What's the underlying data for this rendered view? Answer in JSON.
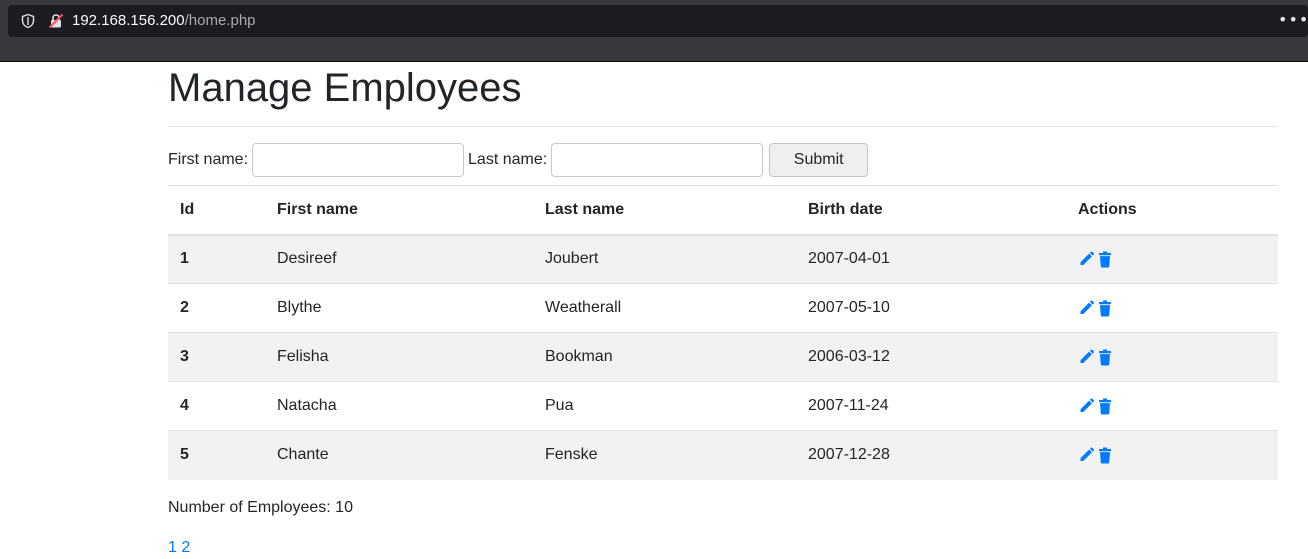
{
  "browser": {
    "url_host": "192.168.156.200",
    "url_path": "/home.php",
    "menu_glyph": "•••",
    "icons": {
      "shield": "shield-icon",
      "insecure": "insecure-lock-icon",
      "menu": "more-menu-icon"
    }
  },
  "page": {
    "title": "Manage Employees"
  },
  "search": {
    "first_label": "First name:",
    "first_value": "",
    "last_label": "Last name:",
    "last_value": "",
    "submit_label": "Submit"
  },
  "table": {
    "headers": {
      "id": "Id",
      "first": "First name",
      "last": "Last name",
      "birth": "Birth date",
      "actions": "Actions"
    },
    "rows": [
      {
        "id": "1",
        "first": "Desireef",
        "last": "Joubert",
        "birth": "2007-04-01"
      },
      {
        "id": "2",
        "first": "Blythe",
        "last": "Weatherall",
        "birth": "2007-05-10"
      },
      {
        "id": "3",
        "first": "Felisha",
        "last": "Bookman",
        "birth": "2006-03-12"
      },
      {
        "id": "4",
        "first": "Natacha",
        "last": "Pua",
        "birth": "2007-11-24"
      },
      {
        "id": "5",
        "first": "Chante",
        "last": "Fenske",
        "birth": "2007-12-28"
      }
    ],
    "action_icons": [
      "edit-pencil-icon",
      "delete-trash-icon"
    ],
    "icon_color": "#007bff",
    "stripe_color": "#f2f2f2"
  },
  "footer": {
    "count_text": "Number of Employees: 10",
    "pages": [
      "1",
      "2"
    ]
  }
}
